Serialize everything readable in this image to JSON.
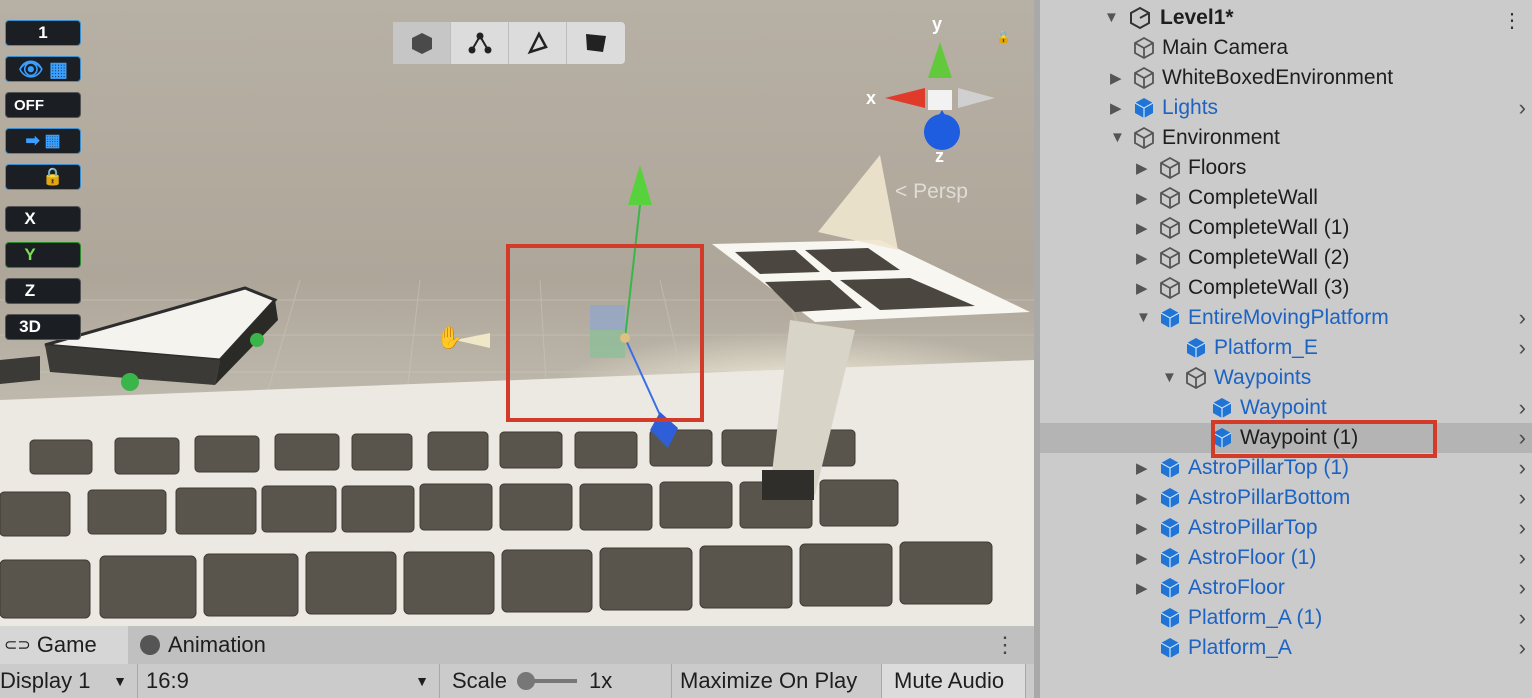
{
  "overlay": {
    "counter": "1",
    "snap_toggle_off": "OFF",
    "axis_x": "X",
    "axis_y": "Y",
    "axis_z": "Z",
    "mode_3d": "3D"
  },
  "scene_tools": [
    {
      "name": "cube-icon",
      "active": true
    },
    {
      "name": "nodes-icon",
      "active": false
    },
    {
      "name": "triangle-icon",
      "active": false
    },
    {
      "name": "flag-icon",
      "active": false
    }
  ],
  "gizmo": {
    "x": "x",
    "y": "y",
    "z": "z",
    "persp": "< Persp"
  },
  "game_bar": {
    "tabs": [
      {
        "label": "Game",
        "icon": "gamepad-icon"
      },
      {
        "label": "Animation",
        "icon": "clock-icon"
      }
    ],
    "display": "Display 1",
    "aspect": "16:9",
    "scale_label": "Scale",
    "scale_value": "1x",
    "maximize": "Maximize On Play",
    "mute": "Mute Audio"
  },
  "hierarchy": {
    "scene_name": "Level1*",
    "items": [
      {
        "label": "Main Camera",
        "indent": 1,
        "arrow": "",
        "prefab": false,
        "go": false,
        "selected": false
      },
      {
        "label": "WhiteBoxedEnvironment",
        "indent": 1,
        "arrow": "▶",
        "prefab": false,
        "go": false,
        "selected": false
      },
      {
        "label": "Lights",
        "indent": 1,
        "arrow": "▶",
        "prefab": true,
        "go": true,
        "selected": false
      },
      {
        "label": "Environment",
        "indent": 1,
        "arrow": "▼",
        "prefab": false,
        "go": false,
        "selected": false
      },
      {
        "label": "Floors",
        "indent": 2,
        "arrow": "▶",
        "prefab": false,
        "go": false,
        "selected": false
      },
      {
        "label": "CompleteWall",
        "indent": 2,
        "arrow": "▶",
        "prefab": false,
        "go": false,
        "selected": false
      },
      {
        "label": "CompleteWall (1)",
        "indent": 2,
        "arrow": "▶",
        "prefab": false,
        "go": false,
        "selected": false
      },
      {
        "label": "CompleteWall (2)",
        "indent": 2,
        "arrow": "▶",
        "prefab": false,
        "go": false,
        "selected": false
      },
      {
        "label": "CompleteWall (3)",
        "indent": 2,
        "arrow": "▶",
        "prefab": false,
        "go": false,
        "selected": false
      },
      {
        "label": "EntireMovingPlatform",
        "indent": 2,
        "arrow": "▼",
        "prefab": true,
        "go": true,
        "selected": false
      },
      {
        "label": "Platform_E",
        "indent": 3,
        "arrow": "",
        "prefab": true,
        "go": true,
        "selected": false
      },
      {
        "label": "Waypoints",
        "indent": 3,
        "arrow": "▼",
        "prefab": false,
        "go": false,
        "textPrefab": true,
        "selected": false
      },
      {
        "label": "Waypoint",
        "indent": 4,
        "arrow": "",
        "prefab": true,
        "go": true,
        "selected": false
      },
      {
        "label": "Waypoint (1)",
        "indent": 4,
        "arrow": "",
        "prefab": true,
        "go": true,
        "selected": true,
        "plainText": true
      },
      {
        "label": "AstroPillarTop (1)",
        "indent": 2,
        "arrow": "▶",
        "prefab": true,
        "go": true,
        "selected": false
      },
      {
        "label": "AstroPillarBottom",
        "indent": 2,
        "arrow": "▶",
        "prefab": true,
        "go": true,
        "selected": false
      },
      {
        "label": "AstroPillarTop",
        "indent": 2,
        "arrow": "▶",
        "prefab": true,
        "go": true,
        "selected": false
      },
      {
        "label": "AstroFloor (1)",
        "indent": 2,
        "arrow": "▶",
        "prefab": true,
        "go": true,
        "selected": false
      },
      {
        "label": "AstroFloor",
        "indent": 2,
        "arrow": "▶",
        "prefab": true,
        "go": true,
        "selected": false
      },
      {
        "label": "Platform_A (1)",
        "indent": 2,
        "arrow": "",
        "prefab": true,
        "go": true,
        "selected": false
      },
      {
        "label": "Platform_A",
        "indent": 2,
        "arrow": "",
        "prefab": true,
        "go": true,
        "selected": false
      }
    ]
  },
  "colors": {
    "highlight": "#d23a2a",
    "prefab_blue": "#1c63c4",
    "overlay_accent": "#3a8fd0"
  }
}
